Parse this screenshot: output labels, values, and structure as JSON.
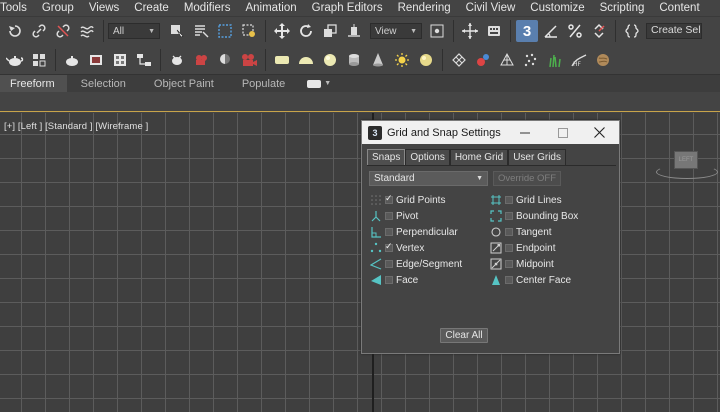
{
  "menu": {
    "items": [
      "Tools",
      "Group",
      "Views",
      "Create",
      "Modifiers",
      "Animation",
      "Graph Editors",
      "Rendering",
      "Civil View",
      "Customize",
      "Scripting",
      "Content"
    ]
  },
  "toolbar": {
    "filter_select": "All",
    "view_select": "View",
    "create_selection_set": "Create Selection Se",
    "snap_toggle_label": "3"
  },
  "ribbon": {
    "tabs": [
      "Freeform",
      "Selection",
      "Object Paint",
      "Populate"
    ]
  },
  "viewport": {
    "label": "[+] [Left ] [Standard ] [Wireframe ]",
    "viewcube_label": "LEFT"
  },
  "dialog": {
    "icon_label": "3",
    "title": "Grid and Snap Settings",
    "tabs": [
      "Snaps",
      "Options",
      "Home Grid",
      "User Grids"
    ],
    "snap_type": "Standard",
    "override_label": "Override OFF",
    "snaps_left": [
      {
        "label": "Grid Points",
        "checked": true
      },
      {
        "label": "Pivot",
        "checked": false
      },
      {
        "label": "Perpendicular",
        "checked": false
      },
      {
        "label": "Vertex",
        "checked": true
      },
      {
        "label": "Edge/Segment",
        "checked": false
      },
      {
        "label": "Face",
        "checked": false
      }
    ],
    "snaps_right": [
      {
        "label": "Grid Lines",
        "checked": false
      },
      {
        "label": "Bounding Box",
        "checked": false
      },
      {
        "label": "Tangent",
        "checked": false
      },
      {
        "label": "Endpoint",
        "checked": false
      },
      {
        "label": "Midpoint",
        "checked": false
      },
      {
        "label": "Center Face",
        "checked": false
      }
    ],
    "clear_all_label": "Clear All"
  },
  "colors": {
    "ui_bg": "#444444",
    "viewport_bg": "#3f3f3f",
    "grid_line": "#5c5c5c",
    "active_button": "#5a7fae",
    "snap_icon": "#56c4c4",
    "ribbon_border": "#c8a44a"
  }
}
